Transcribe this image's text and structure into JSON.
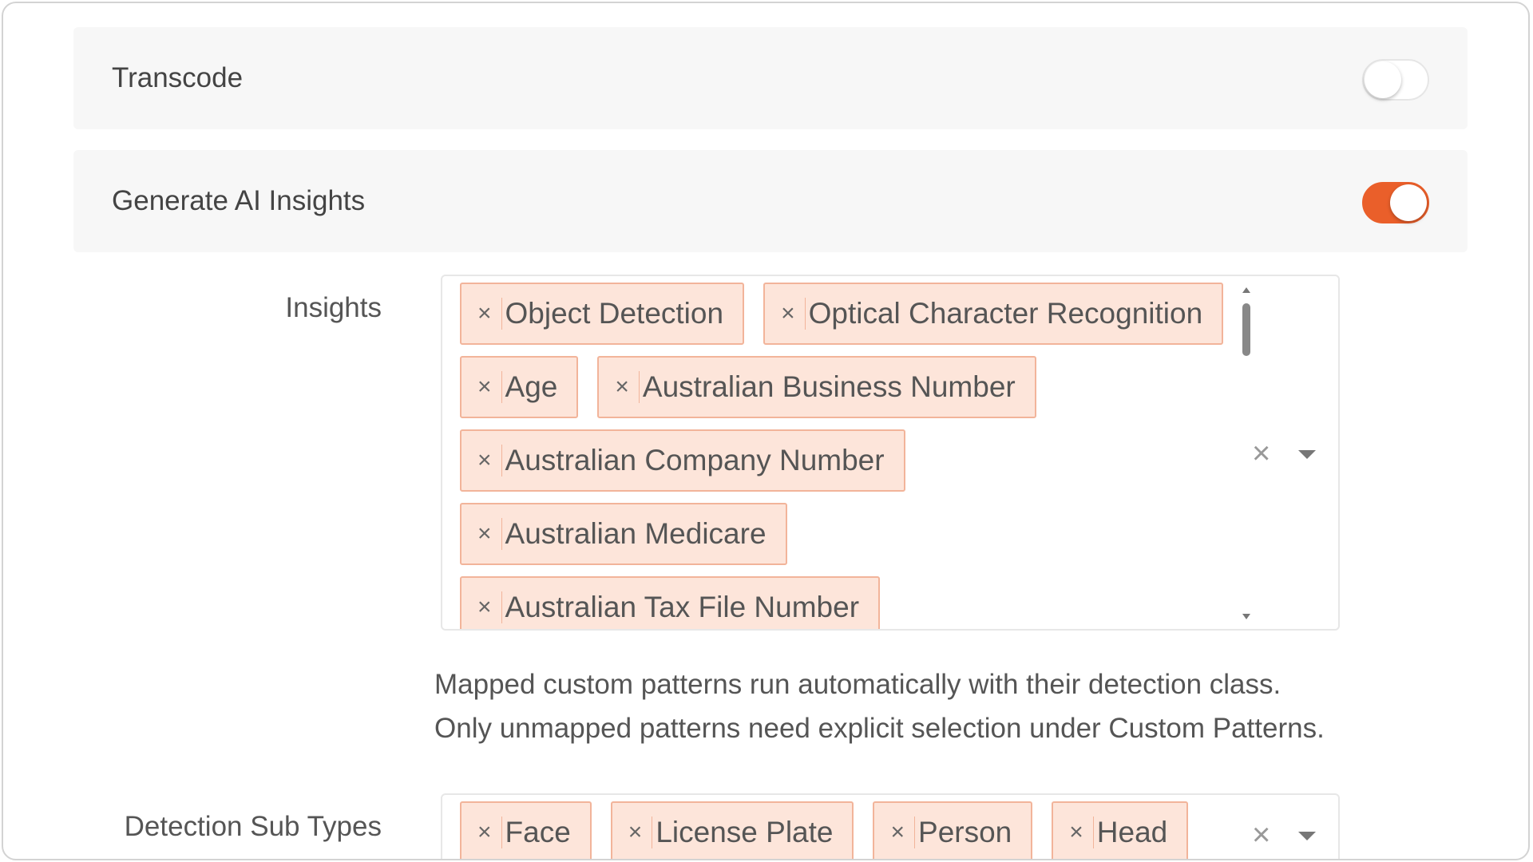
{
  "panels": {
    "transcode": {
      "label": "Transcode",
      "enabled": false
    },
    "ai_insights": {
      "label": "Generate AI Insights",
      "enabled": true
    }
  },
  "insights": {
    "label": "Insights",
    "selected": [
      "Object Detection",
      "Optical Character Recognition",
      "Age",
      "Australian Business Number",
      "Australian Company Number",
      "Australian Medicare",
      "Australian Tax File Number"
    ],
    "remove_glyph": "×",
    "clear_glyph": "×"
  },
  "help_text": "Mapped custom patterns run automatically with their detection class. Only unmapped patterns need explicit selection under Custom Patterns.",
  "detection_sub_types": {
    "label": "Detection Sub Types",
    "selected": [
      "Face",
      "License Plate",
      "Person",
      "Head"
    ],
    "remove_glyph": "×",
    "clear_glyph": "×"
  },
  "colors": {
    "accent": "#ea5f2a",
    "chip_bg": "#fde5da",
    "chip_border": "#f2b49a",
    "panel_bg": "#f7f7f7"
  }
}
